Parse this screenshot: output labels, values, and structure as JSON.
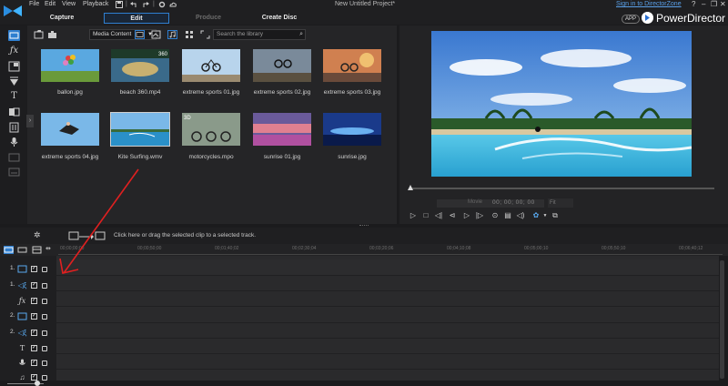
{
  "menu": {
    "file": "File",
    "edit": "Edit",
    "view": "View",
    "playback": "Playback"
  },
  "project_title": "New Untitled Project*",
  "zone_link": "Sign in to DirectorZone",
  "window_buttons": {
    "help": "?",
    "minimize": "–",
    "restore": "❐",
    "close": "✕"
  },
  "mode_tabs": {
    "capture": "Capture",
    "edit": "Edit",
    "produce": "Produce",
    "create_disc": "Create Disc"
  },
  "app_badge": "APP",
  "brand_name": "PowerDirector",
  "library": {
    "media_select": "Media Content",
    "search_placeholder": "Search the library",
    "items": [
      {
        "name": "ballon.jpg",
        "icon": "image"
      },
      {
        "name": "beach 360.mp4",
        "icon": "video-360",
        "badge": "360"
      },
      {
        "name": "extreme sports 01.jpg",
        "icon": "image"
      },
      {
        "name": "extreme sports 02.jpg",
        "icon": "image"
      },
      {
        "name": "extreme sports 03.jpg",
        "icon": "image"
      },
      {
        "name": "extreme sports 04.jpg",
        "icon": "image"
      },
      {
        "name": "Kite Surfing.wmv",
        "icon": "video",
        "selected": true
      },
      {
        "name": "motorcycles.mpo",
        "icon": "3d-image",
        "badge": "3D"
      },
      {
        "name": "sunrise 01.jpg",
        "icon": "image"
      },
      {
        "name": "sunrise.jpg",
        "icon": "image"
      }
    ]
  },
  "preview": {
    "mode_label": "Movie",
    "timecode": "00; 00; 00; 00",
    "zoom_label": "Fit"
  },
  "timeline": {
    "hint_text": "Click here or drag the selected clip to a selected track.",
    "ruler_ticks": [
      "00;00;00;00",
      "00;00;50;00",
      "00;01;40;02",
      "00;02;30;04",
      "00;03;20;06",
      "00;04;10;08",
      "00;05;00;10",
      "00;05;50;10",
      "00;06;40;12"
    ],
    "tracks": [
      {
        "num": "1.",
        "type": "video",
        "icon": "video-track-icon"
      },
      {
        "num": "1.",
        "type": "audio",
        "icon": "audio-track-icon"
      },
      {
        "num": "",
        "type": "effect",
        "icon": "fx-track-icon"
      },
      {
        "num": "2.",
        "type": "video",
        "icon": "video-track-icon"
      },
      {
        "num": "2.",
        "type": "audio",
        "icon": "audio-track-icon"
      },
      {
        "num": "",
        "type": "title",
        "icon": "title-track-icon"
      },
      {
        "num": "",
        "type": "voice",
        "icon": "microphone-icon"
      },
      {
        "num": "",
        "type": "music",
        "icon": "music-note-icon"
      }
    ]
  },
  "colors": {
    "accent": "#2f7fd0",
    "background": "#1b1b1d",
    "annotation": "#e02020"
  }
}
